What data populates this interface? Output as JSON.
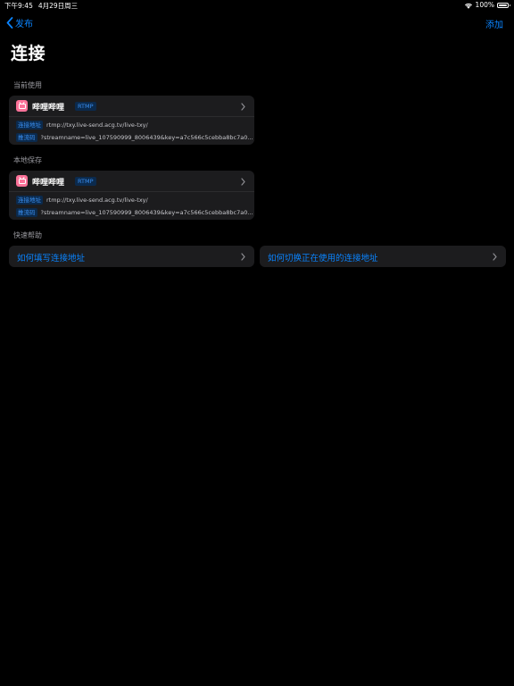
{
  "status_bar": {
    "time": "下午9:45",
    "date": "4月29日周三",
    "battery": "100%"
  },
  "nav": {
    "back_label": "发布",
    "add_label": "添加"
  },
  "page_title": "连接",
  "sections": {
    "current": {
      "header": "当前使用",
      "card": {
        "platform": "哔哩哔哩",
        "protocol": "RTMP",
        "address_label": "连接地址",
        "address_value": "rtmp://txy.live-send.acg.tv/live-txy/",
        "key_label": "推流码",
        "key_value": "?streamname=live_107590999_8006439&key=a7c566c5cebba8bc7a0..."
      }
    },
    "local": {
      "header": "本地保存",
      "card": {
        "platform": "哔哩哔哩",
        "protocol": "RTMP",
        "address_label": "连接地址",
        "address_value": "rtmp://txy.live-send.acg.tv/live-txy/",
        "key_label": "推流码",
        "key_value": "?streamname=live_107590999_8006439&key=a7c566c5cebba8bc7a0..."
      }
    },
    "help": {
      "header": "快速帮助",
      "items": [
        {
          "label": "如何填写连接地址"
        },
        {
          "label": "如何切换正在使用的连接地址"
        }
      ]
    }
  },
  "colors": {
    "accent": "#0a84ff",
    "background": "#000000",
    "card": "#1c1c1e",
    "bilibili_pink": "#fb7299"
  }
}
